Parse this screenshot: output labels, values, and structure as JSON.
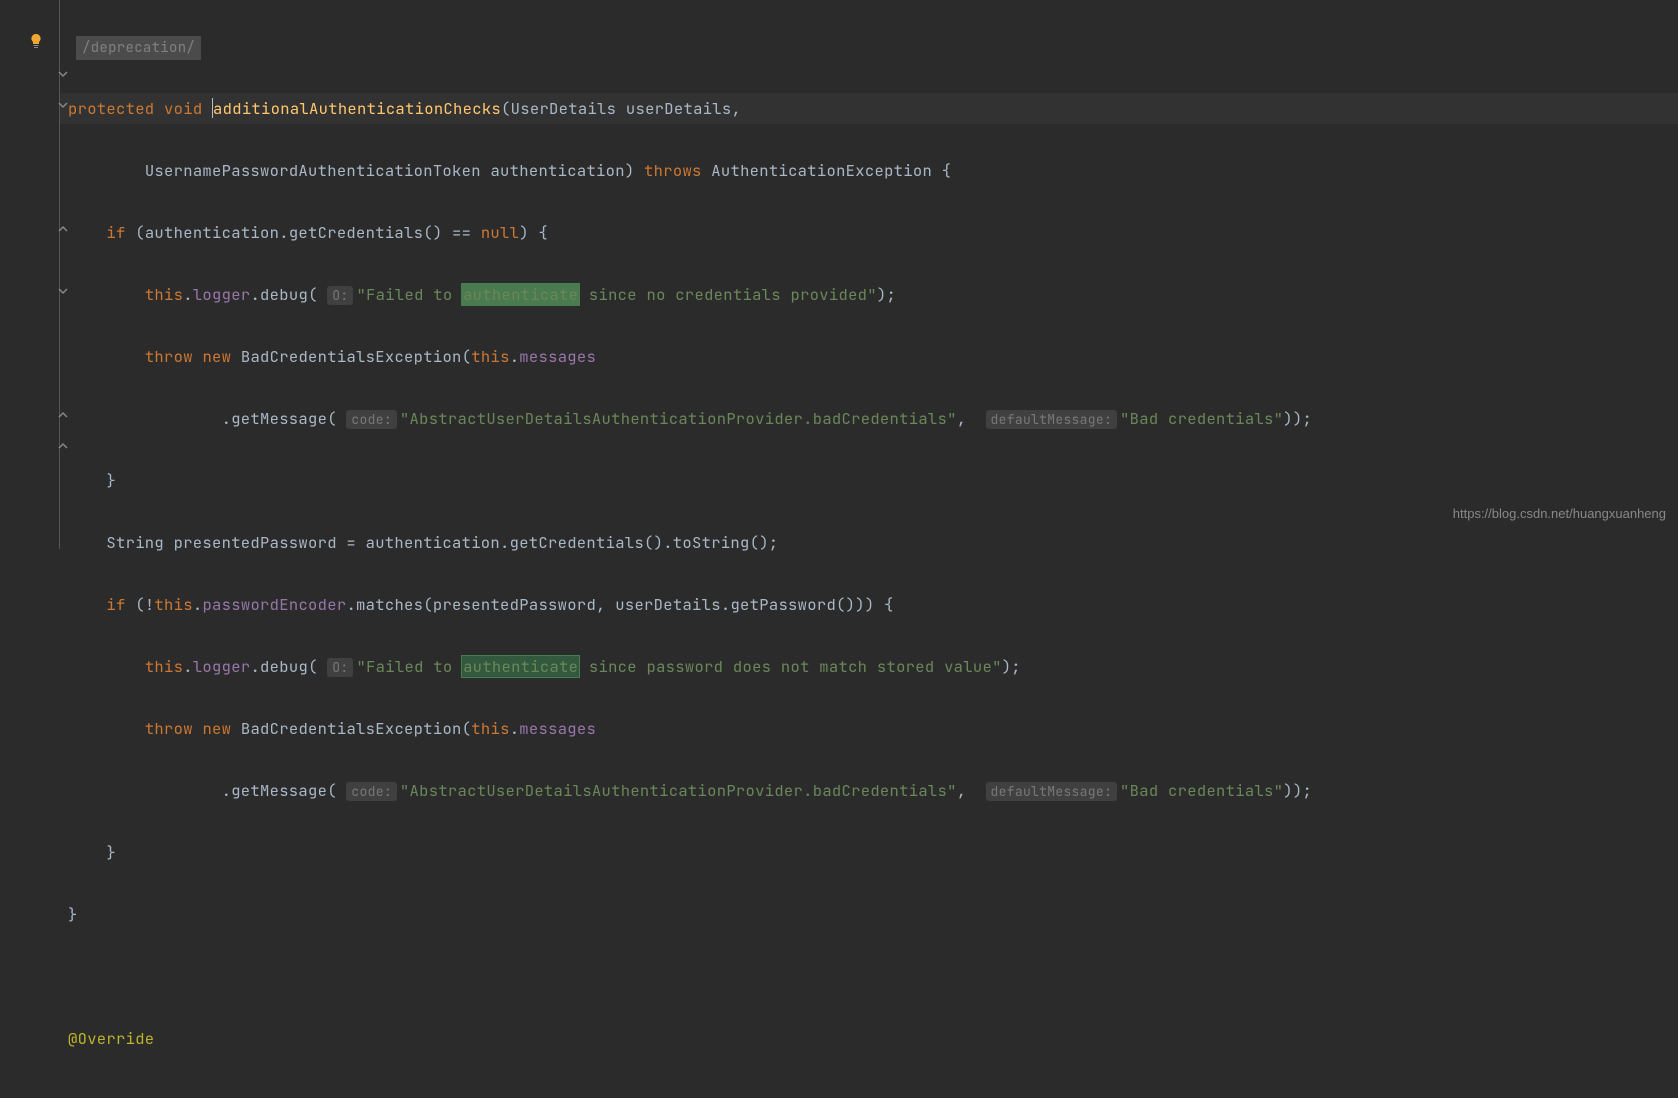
{
  "breadcrumb": "/deprecation/",
  "watermark": "https://blog.csdn.net/huangxuanheng",
  "hints": {
    "o": "O:",
    "code": "code:",
    "defaultMessage": "defaultMessage:"
  },
  "tokens": {
    "protected": "protected",
    "void": "void",
    "if": "if",
    "this": "this",
    "null": "null",
    "throw": "throw",
    "new": "new",
    "throws": "throws",
    "override": "@Override"
  },
  "code": {
    "methodName": "additionalAuthenticationChecks",
    "paramType1": "UserDetails",
    "paramName1": "userDetails",
    "paramType2": "UsernamePasswordAuthenticationToken",
    "paramName2": "authentication",
    "throwsType": "AuthenticationException",
    "cond1a": "(authentication.getCredentials() == ",
    "cond1b": ") {",
    "logger": "logger",
    "debug": "debug",
    "str1a": "\"Failed to ",
    "hl1": "authenticate",
    "str1b": " since no credentials provided\"",
    "badCred": "BadCredentialsException",
    "messages": "messages",
    "getMessage": ".getMessage(",
    "msgKey": "\"AbstractUserDetailsAuthenticationProvider.badCredentials\"",
    "msgDefault": "\"Bad credentials\"",
    "line8": "String presentedPassword = authentication.getCredentials().toString();",
    "cond2a": "(!",
    "passwordEncoder": "passwordEncoder",
    "cond2b": ".matches(presentedPassword, userDetails.getPassword())) {",
    "str2a": "\"Failed to ",
    "hl2": "authenticate",
    "str2b": " since password does not match stored value\"",
    "closeBrace": "}",
    "openBrace": "{",
    "closeBrace2": "}"
  }
}
